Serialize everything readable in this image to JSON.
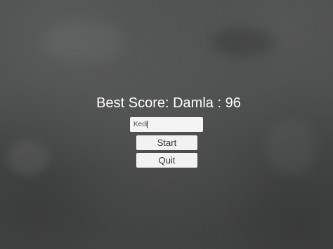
{
  "menu": {
    "best_score_label": "Best Score: Damla : 96",
    "name_input_value": "Kedi",
    "start_label": "Start",
    "quit_label": "Quit"
  },
  "colors": {
    "background": "#4a4c4b",
    "text": "#ffffff",
    "button_bg": "#f2f2f2",
    "button_text": "#333333"
  }
}
